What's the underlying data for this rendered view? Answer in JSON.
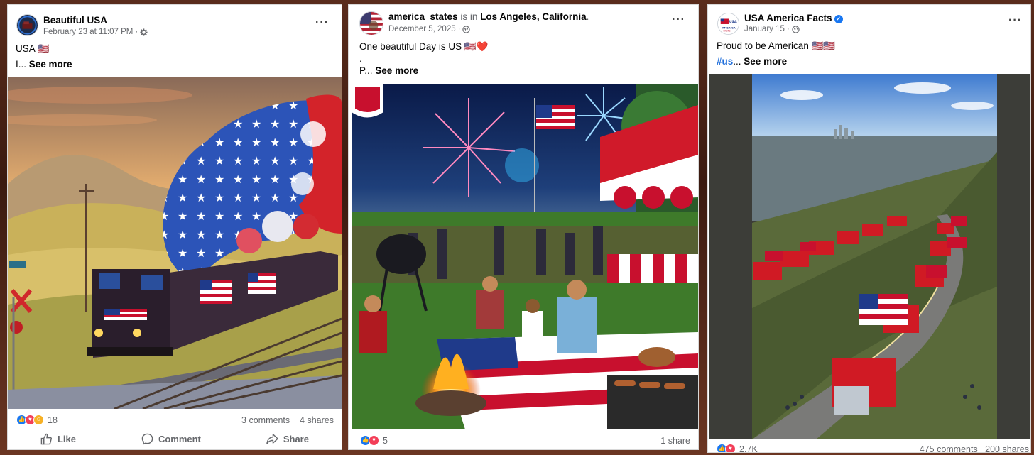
{
  "posts": [
    {
      "author": "Beautiful USA",
      "timestamp": "February 23 at 11:07 PM",
      "audience_icon": "gear-icon",
      "caption_line1": "USA 🇺🇸",
      "caption_line2_prefix": "I...",
      "see_more": "See more",
      "image_subject": "locomotive-with-flag-smoke",
      "reaction_icons": [
        "like",
        "love",
        "care"
      ],
      "reaction_count": "18",
      "comments": "3 comments",
      "shares": "4 shares",
      "actions": {
        "like": "Like",
        "comment": "Comment",
        "share": "Share"
      }
    },
    {
      "author": "america_states",
      "location_prefix": "is in",
      "location": "Los Angeles, California",
      "location_suffix": ".",
      "timestamp": "December 5, 2025",
      "audience_icon": "globe-icon",
      "caption_line1": "One beautiful Day is US 🇺🇸❤️",
      "caption_line2": ".",
      "caption_line3_prefix": "P...",
      "see_more": "See more",
      "image_subject": "fourth-of-july-picnic",
      "reaction_icons": [
        "like",
        "love"
      ],
      "reaction_count": "5",
      "shares": "1 share"
    },
    {
      "author": "USA America Facts",
      "verified": true,
      "timestamp": "January 15",
      "audience_icon": "globe-icon",
      "caption_line1": "Proud to be American 🇺🇸🇺🇸",
      "hashtag": "#us",
      "caption_line2_suffix": "...",
      "see_more": "See more",
      "image_subject": "truck-convoy-with-flags",
      "reaction_icons": [
        "like",
        "love"
      ],
      "reaction_count": "2.7K",
      "comments": "475 comments",
      "shares": "200 shares"
    }
  ],
  "colors": {
    "facebook_blue": "#1877f2",
    "love_red": "#f33e58",
    "muted_text": "#65676b",
    "flag_red": "#c8102e",
    "flag_blue": "#1f3a8a"
  }
}
